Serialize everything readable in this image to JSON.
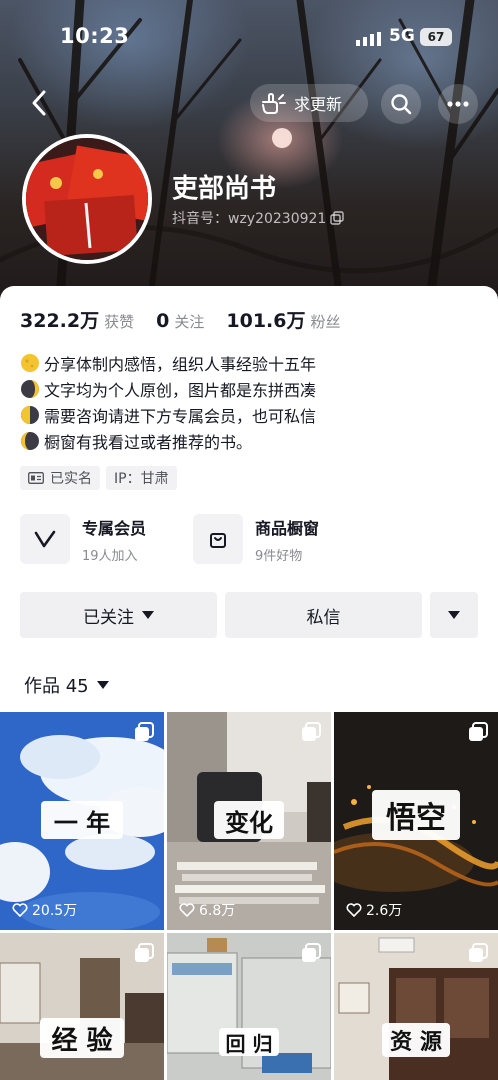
{
  "status_bar": {
    "time": "10:23",
    "network": "5G",
    "battery": "67"
  },
  "header": {
    "request_update_label": "求更新",
    "name": "吏部尚书",
    "douyin_id": "抖音号：wzy20230921"
  },
  "stats": [
    {
      "value": "322.2万",
      "label": "获赞"
    },
    {
      "value": "0",
      "label": "关注"
    },
    {
      "value": "101.6万",
      "label": "粉丝"
    }
  ],
  "bio": [
    "分享体制内感悟，组织人事经验十五年",
    "文字均为个人原创，图片都是东拼西凑",
    "需要咨询请进下方专属会员，也可私信",
    "橱窗有我看过或者推荐的书。"
  ],
  "tags": {
    "verified": "已实名",
    "ip": "IP：甘肃"
  },
  "features": [
    {
      "title": "专属会员",
      "subtitle": "19人加入",
      "icon": "vip-v-icon"
    },
    {
      "title": "商品橱窗",
      "subtitle": "9件好物",
      "icon": "shopping-bag-icon"
    }
  ],
  "actions": {
    "following": "已关注",
    "message": "私信"
  },
  "works": {
    "label": "作品 45"
  },
  "videos": [
    {
      "caption": "一 年",
      "likes": "20.5万"
    },
    {
      "caption": "变化",
      "likes": "6.8万"
    },
    {
      "caption": "悟空",
      "likes": "2.6万"
    },
    {
      "caption": "经 验",
      "likes": ""
    },
    {
      "caption": "回 归",
      "likes": ""
    },
    {
      "caption": "资 源",
      "likes": ""
    }
  ],
  "colors": {
    "text": "#161823",
    "secondary": "#8a8b91",
    "button_bg": "#f0f0f2"
  }
}
